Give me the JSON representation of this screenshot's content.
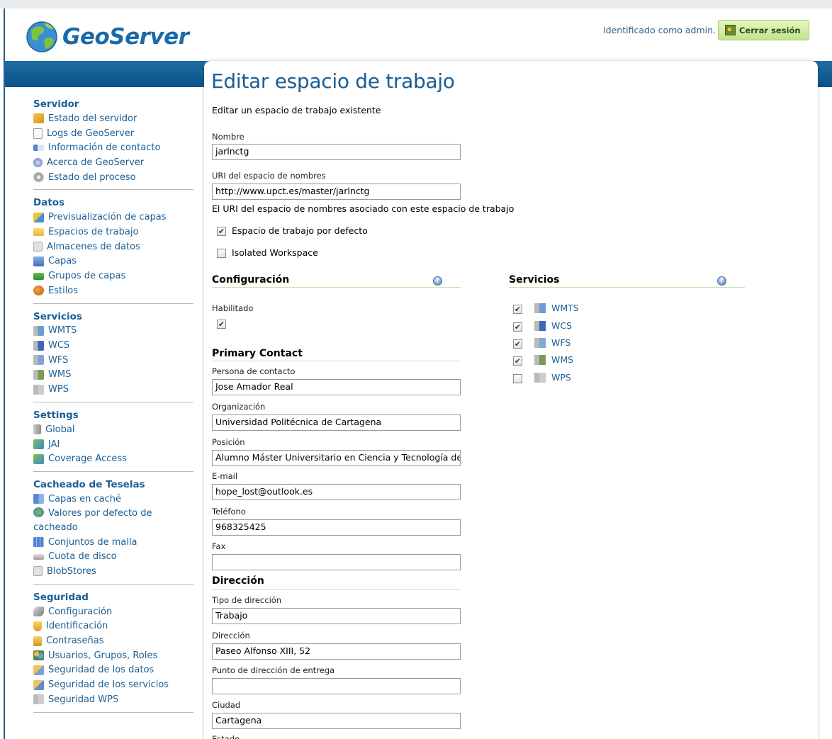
{
  "header": {
    "logo_text": "GeoServer",
    "logged_in_text": "Identificado como admin.",
    "logout_label": "Cerrar sesión"
  },
  "sidebar": {
    "sections": [
      {
        "title": "Servidor",
        "items": [
          "Estado del servidor",
          "Logs de GeoServer",
          "Información de contacto",
          "Acerca de GeoServer",
          "Estado del proceso"
        ]
      },
      {
        "title": "Datos",
        "items": [
          "Previsualización de capas",
          "Espacios de trabajo",
          "Almacenes de datos",
          "Capas",
          "Grupos de capas",
          "Estilos"
        ]
      },
      {
        "title": "Servicios",
        "items": [
          "WMTS",
          "WCS",
          "WFS",
          "WMS",
          "WPS"
        ]
      },
      {
        "title": "Settings",
        "items": [
          "Global",
          "JAI",
          "Coverage Access"
        ]
      },
      {
        "title": "Cacheado de Teselas",
        "items": [
          "Capas en caché",
          "Valores por defecto de cacheado",
          "Conjuntos de malla",
          "Cuota de disco",
          "BlobStores"
        ]
      },
      {
        "title": "Seguridad",
        "items": [
          "Configuración",
          "Identificación",
          "Contraseñas",
          "Usuarios, Grupos, Roles",
          "Seguridad de los datos",
          "Seguridad de los servicios",
          "Seguridad WPS"
        ]
      }
    ]
  },
  "page": {
    "title": "Editar espacio de trabajo",
    "subtitle": "Editar un espacio de trabajo existente",
    "name_label": "Nombre",
    "name_value": "jarlnctg",
    "uri_label": "URI del espacio de nombres",
    "uri_value": "http://www.upct.es/master/jarlnctg",
    "uri_help": "El URI del espacio de nombres asociado con este espacio de trabajo",
    "default_ws_label": "Espacio de trabajo por defecto",
    "default_ws_checked": true,
    "isolated_label": "Isolated Workspace",
    "isolated_checked": false
  },
  "config": {
    "heading": "Configuración",
    "enabled_label": "Habilitado",
    "enabled_checked": true
  },
  "contact": {
    "heading": "Primary Contact",
    "person_label": "Persona de contacto",
    "person_value": "Jose Amador Real",
    "org_label": "Organización",
    "org_value": "Universidad Politécnica de Cartagena",
    "position_label": "Posición",
    "position_value": "Alumno Máster Universitario en Ciencia y Tecnología del",
    "email_label": "E-mail",
    "email_value": "hope_lost@outlook.es",
    "phone_label": "Teléfono",
    "phone_value": "968325425",
    "fax_label": "Fax",
    "fax_value": ""
  },
  "address": {
    "heading": "Dirección",
    "type_label": "Tipo de dirección",
    "type_value": "Trabajo",
    "address_label": "Dirección",
    "address_value": "Paseo Alfonso XIII, 52",
    "delivery_label": "Punto de dirección de entrega",
    "delivery_value": "",
    "city_label": "Ciudad",
    "city_value": "Cartagena",
    "state_label": "Estado"
  },
  "services": {
    "heading": "Servicios",
    "items": [
      {
        "label": "WMTS",
        "checked": true
      },
      {
        "label": "WCS",
        "checked": true
      },
      {
        "label": "WFS",
        "checked": true
      },
      {
        "label": "WMS",
        "checked": true
      },
      {
        "label": "WPS",
        "checked": false
      }
    ]
  }
}
